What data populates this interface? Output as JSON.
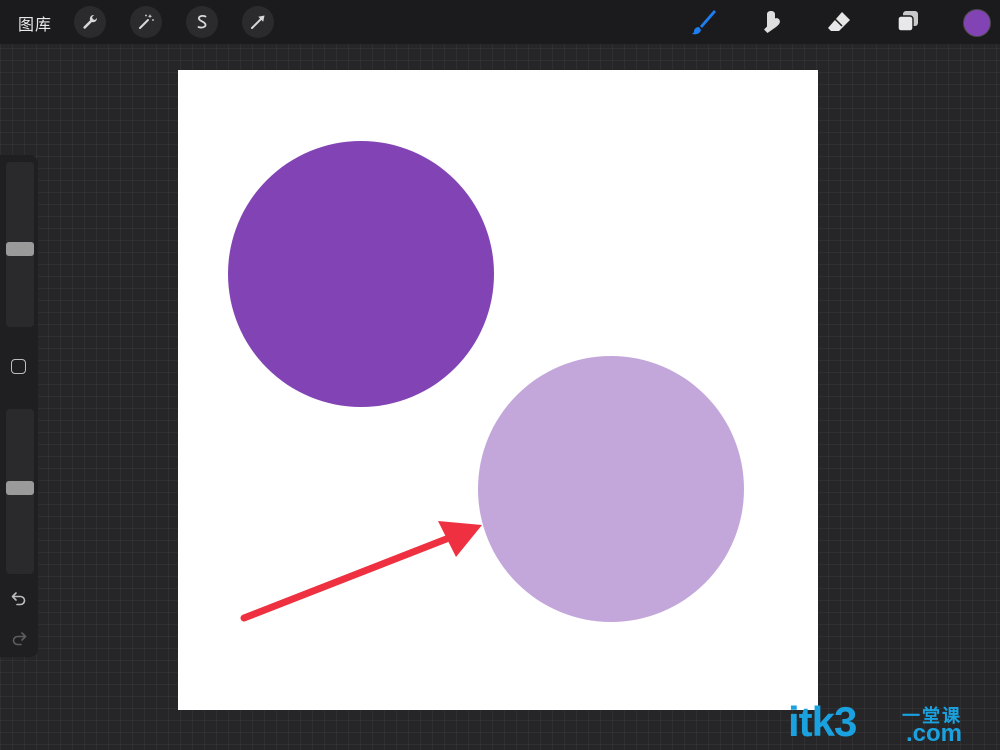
{
  "topbar": {
    "gallery_label": "图库",
    "tools": [
      {
        "icon": "wrench-icon",
        "name": "actions"
      },
      {
        "icon": "magic-wand-icon",
        "name": "adjustments"
      },
      {
        "icon": "selection-icon",
        "name": "selection"
      },
      {
        "icon": "transform-arrow-icon",
        "name": "transform"
      }
    ],
    "right_tools": [
      {
        "icon": "brush-icon",
        "active": true
      },
      {
        "icon": "smudge-icon",
        "active": false
      },
      {
        "icon": "eraser-icon",
        "active": false
      },
      {
        "icon": "layers-icon",
        "active": false
      }
    ],
    "current_color": "#8244b4",
    "active_color": "#1e7ef0"
  },
  "sidebar": {
    "brush_size": 0.47,
    "brush_opacity": 0.52,
    "modify_icon": "square-icon",
    "undo_icon": "undo-icon",
    "redo_icon": "redo-icon"
  },
  "canvas": {
    "background": "#ffffff",
    "shapes": [
      {
        "type": "circle",
        "color": "#8244b4"
      },
      {
        "type": "circle",
        "color": "#c3a7db"
      },
      {
        "type": "arrow",
        "color": "#ee3040"
      }
    ]
  },
  "watermark": {
    "main": "itk3",
    "chinese": "一堂课",
    "suffix": ".com",
    "color": "#1aa2e0"
  }
}
